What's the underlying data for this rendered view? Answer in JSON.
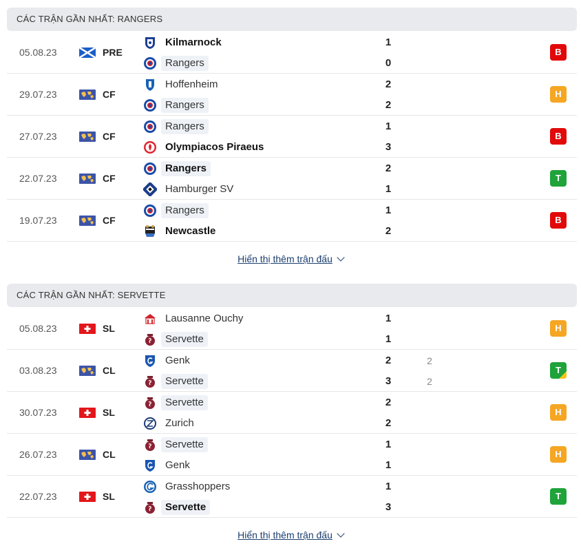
{
  "sections": [
    {
      "title": "CÁC TRẬN GẦN NHẤT: RANGERS",
      "more_label": "Hiển thị thêm trận đấu",
      "matches": [
        {
          "date": "05.08.23",
          "flag": "scotland-flag-icon",
          "comp": "PRE",
          "result": "B",
          "home": {
            "name": "Kilmarnock",
            "logo": "kilmarnock-logo",
            "score": "1",
            "bold": true,
            "hl": false
          },
          "away": {
            "name": "Rangers",
            "logo": "rangers-logo",
            "score": "0",
            "bold": false,
            "hl": true
          }
        },
        {
          "date": "29.07.23",
          "flag": "world-flag-icon",
          "comp": "CF",
          "result": "H",
          "home": {
            "name": "Hoffenheim",
            "logo": "hoffenheim-logo",
            "score": "2",
            "bold": false,
            "hl": false
          },
          "away": {
            "name": "Rangers",
            "logo": "rangers-logo",
            "score": "2",
            "bold": false,
            "hl": true
          }
        },
        {
          "date": "27.07.23",
          "flag": "world-flag-icon",
          "comp": "CF",
          "result": "B",
          "home": {
            "name": "Rangers",
            "logo": "rangers-logo",
            "score": "1",
            "bold": false,
            "hl": true
          },
          "away": {
            "name": "Olympiacos Piraeus",
            "logo": "olympiacos-logo",
            "score": "3",
            "bold": true,
            "hl": false
          }
        },
        {
          "date": "22.07.23",
          "flag": "world-flag-icon",
          "comp": "CF",
          "result": "T",
          "home": {
            "name": "Rangers",
            "logo": "rangers-logo",
            "score": "2",
            "bold": true,
            "hl": true
          },
          "away": {
            "name": "Hamburger SV",
            "logo": "hamburger-logo",
            "score": "1",
            "bold": false,
            "hl": false
          }
        },
        {
          "date": "19.07.23",
          "flag": "world-flag-icon",
          "comp": "CF",
          "result": "B",
          "home": {
            "name": "Rangers",
            "logo": "rangers-logo",
            "score": "1",
            "bold": false,
            "hl": true
          },
          "away": {
            "name": "Newcastle",
            "logo": "newcastle-logo",
            "score": "2",
            "bold": true,
            "hl": false
          }
        }
      ]
    },
    {
      "title": "CÁC TRẬN GẦN NHẤT: SERVETTE",
      "more_label": "Hiển thị thêm trận đấu",
      "matches": [
        {
          "date": "05.08.23",
          "flag": "swiss-flag-icon",
          "comp": "SL",
          "result": "H",
          "home": {
            "name": "Lausanne Ouchy",
            "logo": "lausanne-logo",
            "score": "1",
            "bold": false,
            "hl": false
          },
          "away": {
            "name": "Servette",
            "logo": "servette-logo",
            "score": "1",
            "bold": false,
            "hl": true
          }
        },
        {
          "date": "03.08.23",
          "flag": "world-flag-icon",
          "comp": "CL",
          "result": "T",
          "result_corner": true,
          "home": {
            "name": "Genk",
            "logo": "genk-logo",
            "score": "2",
            "pen": "2",
            "bold": false,
            "hl": false
          },
          "away": {
            "name": "Servette",
            "logo": "servette-logo",
            "score": "3",
            "pen": "2",
            "bold": false,
            "hl": true
          }
        },
        {
          "date": "30.07.23",
          "flag": "swiss-flag-icon",
          "comp": "SL",
          "result": "H",
          "home": {
            "name": "Servette",
            "logo": "servette-logo",
            "score": "2",
            "bold": false,
            "hl": true
          },
          "away": {
            "name": "Zurich",
            "logo": "zurich-logo",
            "score": "2",
            "bold": false,
            "hl": false
          }
        },
        {
          "date": "26.07.23",
          "flag": "world-flag-icon",
          "comp": "CL",
          "result": "H",
          "home": {
            "name": "Servette",
            "logo": "servette-logo",
            "score": "1",
            "bold": false,
            "hl": true
          },
          "away": {
            "name": "Genk",
            "logo": "genk-logo",
            "score": "1",
            "bold": false,
            "hl": false
          }
        },
        {
          "date": "22.07.23",
          "flag": "swiss-flag-icon",
          "comp": "SL",
          "result": "T",
          "home": {
            "name": "Grasshoppers",
            "logo": "grasshoppers-logo",
            "score": "1",
            "bold": false,
            "hl": false
          },
          "away": {
            "name": "Servette",
            "logo": "servette-logo",
            "score": "3",
            "bold": true,
            "hl": true
          }
        }
      ]
    }
  ],
  "colors": {
    "loss": "#e10a0a",
    "draw": "#f5a623",
    "win": "#1fa33a",
    "link": "#1a3d6e"
  }
}
